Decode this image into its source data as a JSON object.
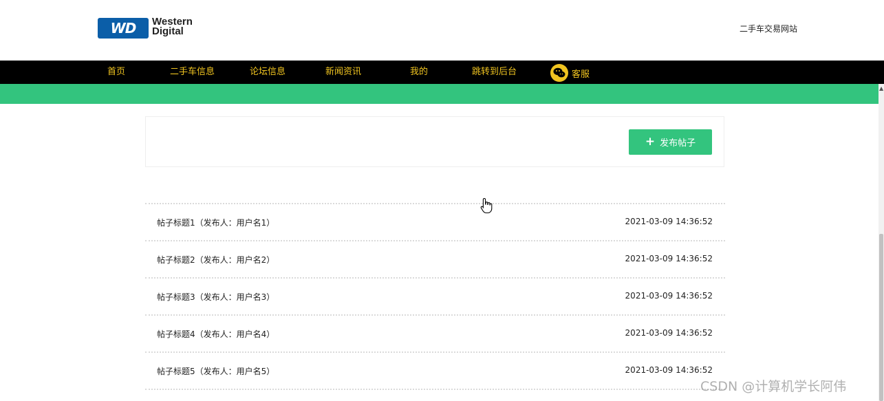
{
  "header": {
    "logo_badge": "WD",
    "logo_line1": "Western",
    "logo_line2": "Digital",
    "site_name": "二手车交易网站"
  },
  "nav": {
    "items": [
      "首页",
      "二手车信息",
      "论坛信息",
      "新闻资讯",
      "我的",
      "跳转到后台"
    ],
    "service_label": "客服",
    "service_icon": "wechat-icon",
    "text_color": "#f0c420",
    "background": "#000000"
  },
  "colors": {
    "accent_green": "#33c47e"
  },
  "toolbar": {
    "publish_label": "发布帖子",
    "publish_icon": "plus-icon"
  },
  "posts": [
    {
      "title": "帖子标题1（发布人：用户名1）",
      "time": "2021-03-09 14:36:52"
    },
    {
      "title": "帖子标题2（发布人：用户名2）",
      "time": "2021-03-09 14:36:52"
    },
    {
      "title": "帖子标题3（发布人：用户名3）",
      "time": "2021-03-09 14:36:52"
    },
    {
      "title": "帖子标题4（发布人：用户名4）",
      "time": "2021-03-09 14:36:52"
    },
    {
      "title": "帖子标题5（发布人：用户名5）",
      "time": "2021-03-09 14:36:52"
    }
  ],
  "watermark": "CSDN @计算机学长阿伟"
}
